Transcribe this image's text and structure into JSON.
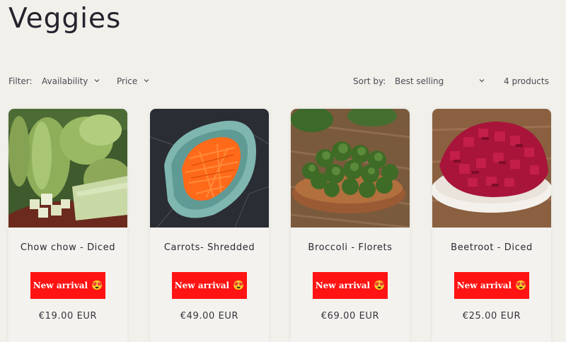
{
  "page": {
    "title": "Veggies"
  },
  "filters": {
    "label": "Filter:",
    "availability": "Availability",
    "price": "Price",
    "sort_label": "Sort by:",
    "sort_value": "Best selling",
    "count": "4 products"
  },
  "products": [
    {
      "name": "Chow chow - Diced",
      "badge": "New arrival",
      "emoji": "😍",
      "price": "€19.00 EUR"
    },
    {
      "name": "Carrots- Shredded",
      "badge": "New arrival",
      "emoji": "😍",
      "price": "€49.00 EUR"
    },
    {
      "name": "Broccoli - Florets",
      "badge": "New arrival",
      "emoji": "😍",
      "price": "€69.00 EUR"
    },
    {
      "name": "Beetroot - Diced",
      "badge": "New arrival",
      "emoji": "😍",
      "price": "€25.00 EUR"
    }
  ],
  "colors": {
    "badge": "#ff1313",
    "background": "#f1f0eb",
    "text": "#26232e"
  }
}
